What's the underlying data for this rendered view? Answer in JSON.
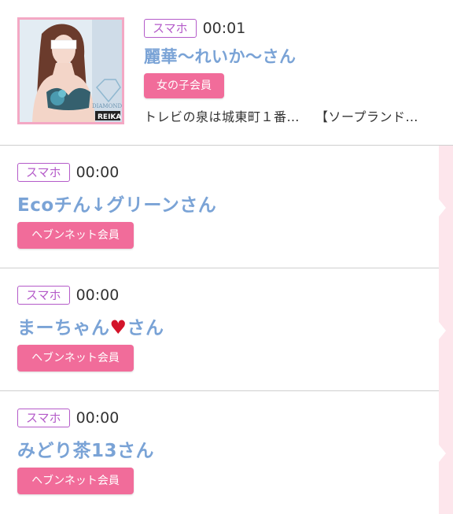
{
  "entries": [
    {
      "device": "スマホ",
      "time": "00:01",
      "name": "麗華〜れいか〜さん",
      "member_type": "女の子会員",
      "snippet_1": "トレビの泉は城東町１番…",
      "snippet_2": "【ソープランド…",
      "photo_watermark": "REIKA",
      "photo_logo": "DIAMOND"
    },
    {
      "device": "スマホ",
      "time": "00:00",
      "name": "Ecoチん↓グリーンさん",
      "member_type": "ヘブンネット会員"
    },
    {
      "device": "スマホ",
      "time": "00:00",
      "name_prefix": "まーちゃん",
      "name_emoji": "♥",
      "name_suffix": "さん",
      "member_type": "ヘブンネット会員"
    },
    {
      "device": "スマホ",
      "time": "00:00",
      "name": "みどり茶13さん",
      "member_type": "ヘブンネット会員"
    }
  ],
  "colors": {
    "name": "#7aa3d6",
    "badge_border": "#b45bc9",
    "member_button": "#f16c9a",
    "thumb_border": "#f4a8c4",
    "side_strip": "#fde6ec"
  }
}
